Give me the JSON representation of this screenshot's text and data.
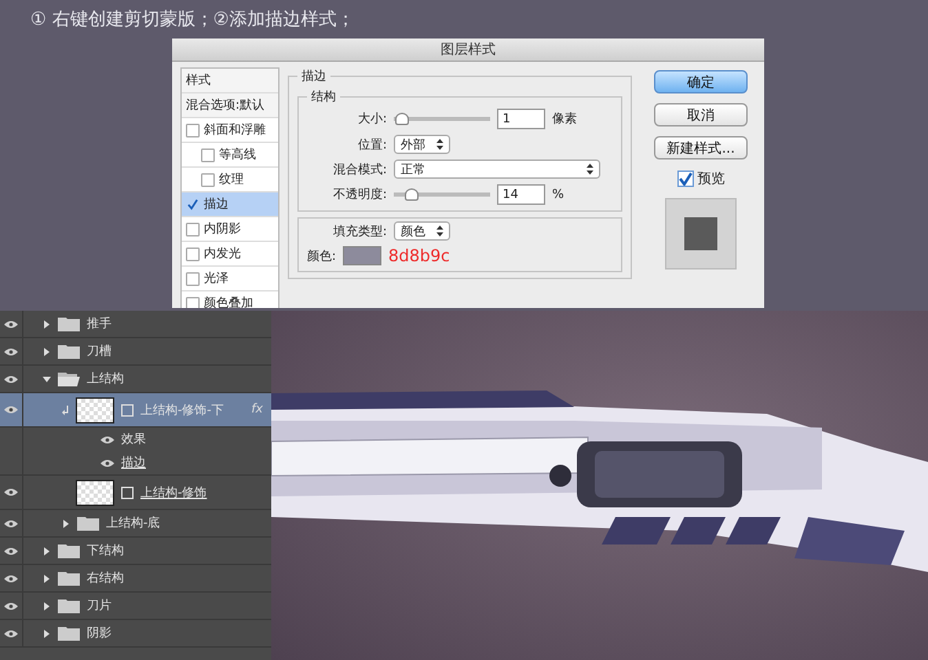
{
  "caption": "① 右键创建剪切蒙版；②添加描边样式；",
  "dialog": {
    "title": "图层样式",
    "sidebar": [
      {
        "kind": "header",
        "label": "样式",
        "selected": false
      },
      {
        "kind": "header",
        "label": "混合选项:默认",
        "selected": false
      },
      {
        "kind": "check",
        "label": "斜面和浮雕",
        "checked": false,
        "selected": false,
        "children": [
          {
            "kind": "check",
            "label": "等高线",
            "checked": false,
            "selected": false
          },
          {
            "kind": "check",
            "label": "纹理",
            "checked": false,
            "selected": false
          }
        ]
      },
      {
        "kind": "check",
        "label": "描边",
        "checked": true,
        "selected": true
      },
      {
        "kind": "check",
        "label": "内阴影",
        "checked": false,
        "selected": false
      },
      {
        "kind": "check",
        "label": "内发光",
        "checked": false,
        "selected": false
      },
      {
        "kind": "check",
        "label": "光泽",
        "checked": false,
        "selected": false
      },
      {
        "kind": "check",
        "label": "颜色叠加",
        "checked": false,
        "selected": false
      }
    ],
    "section_title": "描边",
    "group_title": "结构",
    "size": {
      "label": "大小:",
      "level": 0.02,
      "value": "1",
      "unit": "像素"
    },
    "position": {
      "label": "位置:",
      "value": "外部"
    },
    "blend": {
      "label": "混合模式:",
      "value": "正常"
    },
    "opacity": {
      "label": "不透明度:",
      "level": 0.14,
      "value": "14",
      "unit": "%"
    },
    "fill_type": {
      "label": "填充类型:",
      "value": "颜色"
    },
    "color": {
      "label": "颜色:",
      "color": "#8d8b9c",
      "note": "8d8b9c"
    },
    "buttons": [
      {
        "label": "确定",
        "primary": true
      },
      {
        "label": "取消",
        "primary": false
      },
      {
        "label": "新建样式...",
        "primary": false
      }
    ],
    "preview": {
      "label": "预览",
      "checked": true
    }
  },
  "layers": [
    {
      "kind": "folder",
      "name": "推手",
      "visible": true,
      "expanded": false,
      "selected": false
    },
    {
      "kind": "folder",
      "name": "刀槽",
      "visible": true,
      "expanded": false,
      "selected": false
    },
    {
      "kind": "folder",
      "name": "上结构",
      "visible": true,
      "expanded": true,
      "selected": false,
      "children": [
        {
          "kind": "layer",
          "name": "上结构-修饰-下",
          "visible": true,
          "selected": true,
          "clipped": true,
          "fx": "fx",
          "children": [
            {
              "kind": "effect",
              "name": "效果",
              "visible": true
            },
            {
              "kind": "effect",
              "name": "描边",
              "visible": true,
              "underline": true
            }
          ]
        },
        {
          "kind": "layer",
          "name": "上结构-修饰",
          "visible": true,
          "selected": false,
          "clipped": false,
          "underline": true
        },
        {
          "kind": "folder",
          "name": "上结构-底",
          "visible": true,
          "expanded": false,
          "selected": false
        }
      ]
    },
    {
      "kind": "folder",
      "name": "下结构",
      "visible": true,
      "expanded": false,
      "selected": false
    },
    {
      "kind": "folder",
      "name": "右结构",
      "visible": true,
      "expanded": false,
      "selected": false
    },
    {
      "kind": "folder",
      "name": "刀片",
      "visible": true,
      "expanded": false,
      "selected": false
    },
    {
      "kind": "folder",
      "name": "阴影",
      "visible": true,
      "expanded": false,
      "selected": false
    }
  ]
}
